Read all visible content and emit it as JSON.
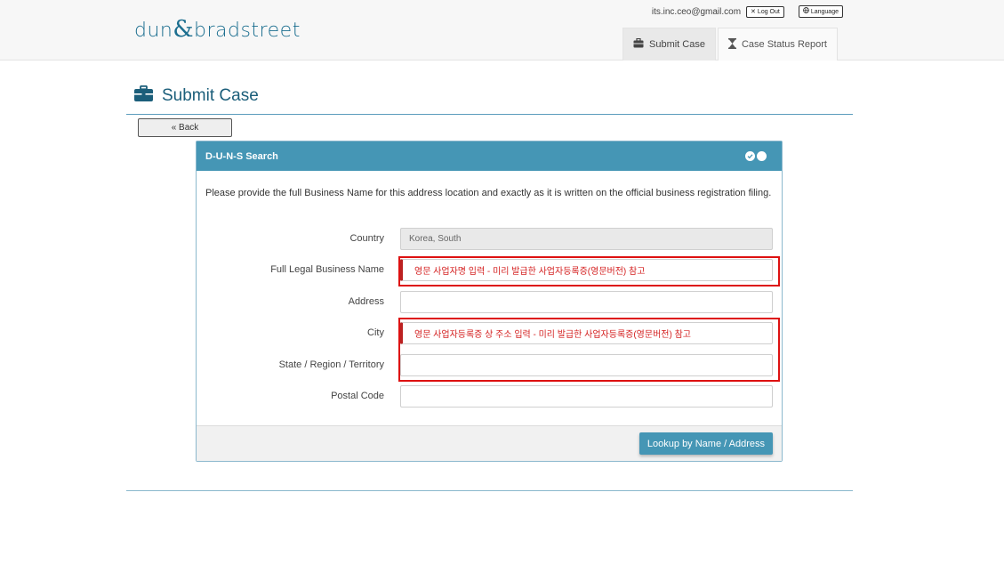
{
  "brand": {
    "left": "dun",
    "amp": "&",
    "right": "bradstreet"
  },
  "user": {
    "email": "its.inc.ceo@gmail.com",
    "logout_label": "Log Out",
    "language_label": "Language"
  },
  "tabs": [
    {
      "label": "Submit Case",
      "icon": "briefcase-icon",
      "active": true
    },
    {
      "label": "Case Status Report",
      "icon": "hourglass-icon",
      "active": false
    }
  ],
  "page": {
    "title": "Submit Case",
    "back_label": "« Back"
  },
  "panel": {
    "title": "D-U-N-S Search",
    "description": "Please provide the full Business Name for this address location and exactly as it is written on the official business registration filing.",
    "fields": [
      {
        "label": "Country",
        "value": "Korea, South"
      },
      {
        "label": "Full Legal Business Name",
        "value": "영문 사업자명 입력 - 미리 발급한 사업자등록증(영문버전) 참고"
      },
      {
        "label": "Address",
        "value": ""
      },
      {
        "label": "City",
        "value": "영문 사업자등록증 상 주소 입력 - 미리 발급한 사업자등록증(영문버전) 참고"
      },
      {
        "label": "State / Region / Territory",
        "value": ""
      },
      {
        "label": "Postal Code",
        "value": ""
      }
    ],
    "lookup_label": "Lookup by Name / Address"
  },
  "colors": {
    "brand": "#1b6e8f",
    "panel_header": "#4596b5",
    "annotation": "#dd1111"
  }
}
